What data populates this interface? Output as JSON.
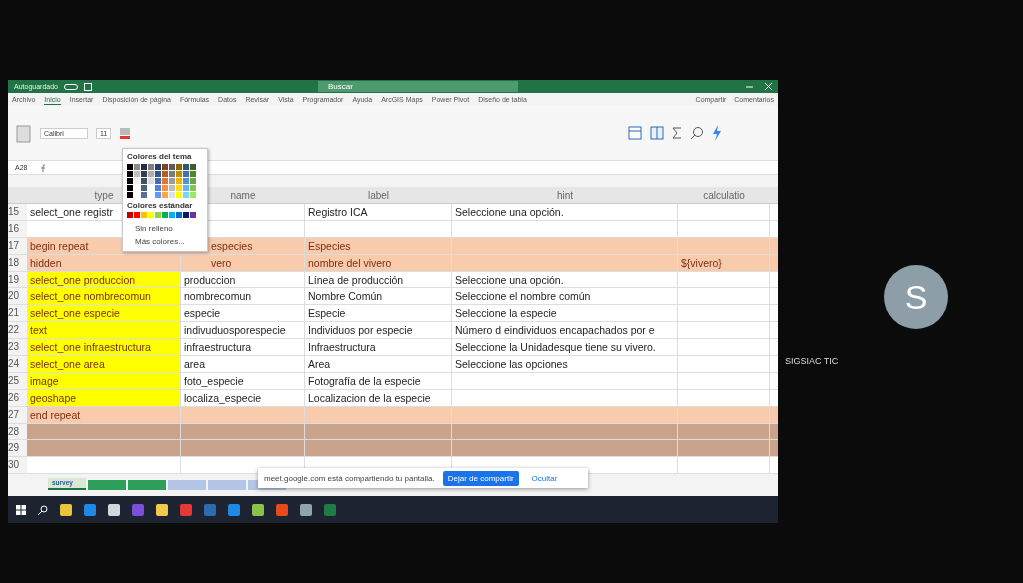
{
  "excel": {
    "title_bar": {
      "autosave": "Autoguardado",
      "autosave_on": false,
      "search_placeholder": "Buscar"
    },
    "ribbon_tabs": [
      {
        "label": "Archivo",
        "selected": false
      },
      {
        "label": "Inicio",
        "selected": true
      },
      {
        "label": "Insertar",
        "selected": false
      },
      {
        "label": "Disposición de página",
        "selected": false
      },
      {
        "label": "Fórmulas",
        "selected": false
      },
      {
        "label": "Datos",
        "selected": false
      },
      {
        "label": "Revisar",
        "selected": false
      },
      {
        "label": "Vista",
        "selected": false
      },
      {
        "label": "Programador",
        "selected": false
      },
      {
        "label": "Ayuda",
        "selected": false
      },
      {
        "label": "ArcGIS Maps",
        "selected": false
      },
      {
        "label": "Power Pivot",
        "selected": false
      },
      {
        "label": "Diseño de tabla",
        "selected": false
      }
    ],
    "share_button": "Compartir",
    "comments_button": "Comentarios",
    "font_name": "Calibri",
    "font_size": "11",
    "name_box": "A28",
    "color_menu": {
      "theme_title": "Colores del tema",
      "standard_title": "Colores estándar",
      "no_fill": "Sin relleno",
      "more_colors": "Más colores..."
    },
    "columns": [
      "type",
      "name",
      "label",
      "hint",
      "calculatio"
    ],
    "rows": [
      {
        "number": "15",
        "kind": "plain",
        "type_highlight": false,
        "cells": [
          "select_one registr",
          "",
          "Registro ICA",
          "Seleccione una opción.",
          ""
        ]
      },
      {
        "number": "16",
        "kind": "plain",
        "type_highlight": false,
        "cells": [
          "",
          "",
          "",
          "",
          ""
        ]
      },
      {
        "number": "17",
        "kind": "group",
        "type_highlight": false,
        "cells": [
          "begin repeat",
          "especies",
          "Especies",
          "",
          ""
        ]
      },
      {
        "number": "18",
        "kind": "group",
        "type_highlight": false,
        "cells": [
          "hidden",
          "vero",
          "nombre del vivero",
          "",
          "${vivero}"
        ]
      },
      {
        "number": "19",
        "kind": "plain",
        "type_highlight": true,
        "cells": [
          "select_one produccion",
          "produccion",
          "Línea de producción",
          "Seleccione una opción.",
          ""
        ]
      },
      {
        "number": "20",
        "kind": "plain",
        "type_highlight": true,
        "cells": [
          "select_one  nombrecomun",
          "nombrecomun",
          "Nombre Común",
          "Seleccione el nombre común",
          ""
        ]
      },
      {
        "number": "21",
        "kind": "plain",
        "type_highlight": true,
        "cells": [
          "select_one especie",
          "especie",
          "Especie",
          "Seleccione la especie",
          ""
        ]
      },
      {
        "number": "22",
        "kind": "plain",
        "type_highlight": true,
        "cells": [
          "text",
          "indivuduosporespecie",
          "Individuos por especie",
          "Número d eindividuos encapachados por e",
          ""
        ]
      },
      {
        "number": "23",
        "kind": "plain",
        "type_highlight": true,
        "cells": [
          "select_one infraestructura",
          "infraestructura",
          "Infraestructura",
          "Seleccione la Unidadesque tiene su vivero.",
          ""
        ]
      },
      {
        "number": "24",
        "kind": "plain",
        "type_highlight": true,
        "cells": [
          "select_one area",
          "area",
          "Area",
          "Seleccione las opciones",
          ""
        ]
      },
      {
        "number": "25",
        "kind": "plain",
        "type_highlight": true,
        "cells": [
          "image",
          "foto_especie",
          "Fotografía de la especie",
          "",
          ""
        ]
      },
      {
        "number": "26",
        "kind": "plain",
        "type_highlight": true,
        "cells": [
          "geoshape",
          "localiza_especie",
          "Localizacion de la especie",
          "",
          ""
        ]
      },
      {
        "number": "27",
        "kind": "group",
        "type_highlight": false,
        "cells": [
          "end repeat",
          "",
          "",
          "",
          ""
        ]
      },
      {
        "number": "28",
        "kind": "brown",
        "type_highlight": false,
        "cells": [
          "",
          "",
          "",
          "",
          ""
        ]
      },
      {
        "number": "29",
        "kind": "brown",
        "type_highlight": false,
        "cells": [
          "",
          "",
          "",
          "",
          ""
        ]
      },
      {
        "number": "30",
        "kind": "plain",
        "type_highlight": false,
        "cells": [
          "",
          "",
          "",
          "",
          ""
        ]
      }
    ],
    "sheet_tabs": [
      {
        "label": "survey",
        "selected": true,
        "color": "#d9e8d4"
      },
      {
        "selected": false,
        "color": "#2e9e5b"
      },
      {
        "selected": false,
        "color": "#2e9e5b"
      },
      {
        "selected": false,
        "color": "#b4c6e7"
      },
      {
        "selected": false,
        "color": "#b4c6e7"
      },
      {
        "selected": false,
        "color": "#b4c6e7"
      }
    ]
  },
  "share_bar": {
    "message": "meet.google.com está compartiendo tu pantalla.",
    "stop_button": "Dejar de compartir",
    "hide_button": "Ocultar"
  },
  "participant": {
    "initial": "S",
    "name": "SIGSIAC TIC"
  }
}
